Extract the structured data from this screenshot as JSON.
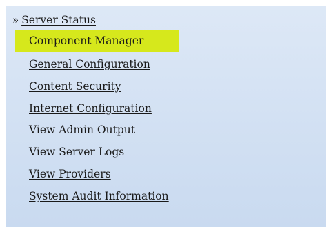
{
  "nav": {
    "items": [
      {
        "label": "Server Status",
        "prefix": "»",
        "current": true
      },
      {
        "label": "Component Manager",
        "highlighted": true
      },
      {
        "label": "General Configuration"
      },
      {
        "label": "Content Security"
      },
      {
        "label": "Internet Configuration"
      },
      {
        "label": "View Admin Output"
      },
      {
        "label": "View Server Logs"
      },
      {
        "label": "View Providers"
      },
      {
        "label": "System Audit Information"
      }
    ]
  },
  "colors": {
    "panel_top": "#dde8f6",
    "panel_bottom": "#c9daf0",
    "highlight": "#d6e81c",
    "link_text": "#1a1a1a"
  },
  "icons": {
    "current_marker": "double-chevron-right-icon"
  }
}
